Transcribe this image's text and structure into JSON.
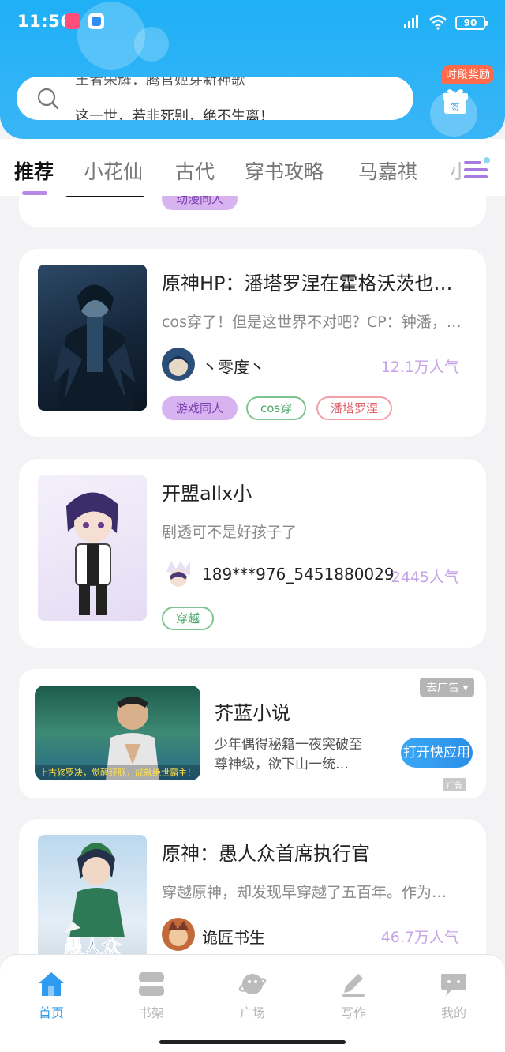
{
  "status": {
    "time": "11:56",
    "battery": "90"
  },
  "search": {
    "hint_top": "王者荣耀：腾官姬芽新神歌",
    "hint": "这一世，若非死别，绝不生离！"
  },
  "reward": {
    "badge": "时段奖励",
    "sign": "签"
  },
  "tabs": [
    {
      "label": "推荐"
    },
    {
      "label": "小花仙"
    },
    {
      "label": "古代"
    },
    {
      "label": "穿书攻略"
    },
    {
      "label": "马嘉祺"
    },
    {
      "label": "小"
    }
  ],
  "feed": {
    "prev_card": {
      "tag": "动漫同人"
    },
    "cards": [
      {
        "title": "原神HP：潘塔罗涅在霍格沃茨也…",
        "desc": "cos穿了！但是这世界不对吧？CP：钟潘，…",
        "author": "丶零度丶",
        "popularity": "12.1万人气",
        "tags": [
          "游戏同人",
          "cos穿",
          "潘塔罗涅"
        ]
      },
      {
        "title": "开盟allx小",
        "desc": "剧透可不是好孩子了",
        "author": "189***976_5451880029",
        "popularity": "2445人气",
        "tags": [
          "穿越"
        ]
      },
      {
        "title": "原神：愚人众首席执行官",
        "desc": "穿越原神，却发现早穿越了五百年。作为…",
        "author": "诡匠书生",
        "popularity": "46.7万人气",
        "tags": []
      }
    ],
    "ad": {
      "title": "芥蓝小说",
      "desc": "少年偶得秘籍一夜突破至尊神级，欲下山一统…",
      "close": "去广告",
      "button": "打开快应用",
      "mark": "广告",
      "img_caption": "上古修罗决，觉醒经脉，成就绝世霸主！"
    }
  },
  "cover3_text": "愚人众首席执行官",
  "nav": [
    {
      "label": "首页"
    },
    {
      "label": "书架"
    },
    {
      "label": "广场"
    },
    {
      "label": "写作"
    },
    {
      "label": "我的"
    }
  ],
  "colors": {
    "header": "#1fb0f6",
    "accent": "#b889e6",
    "nav_active": "#2d9bef",
    "popularity": "#c6a3e8"
  }
}
